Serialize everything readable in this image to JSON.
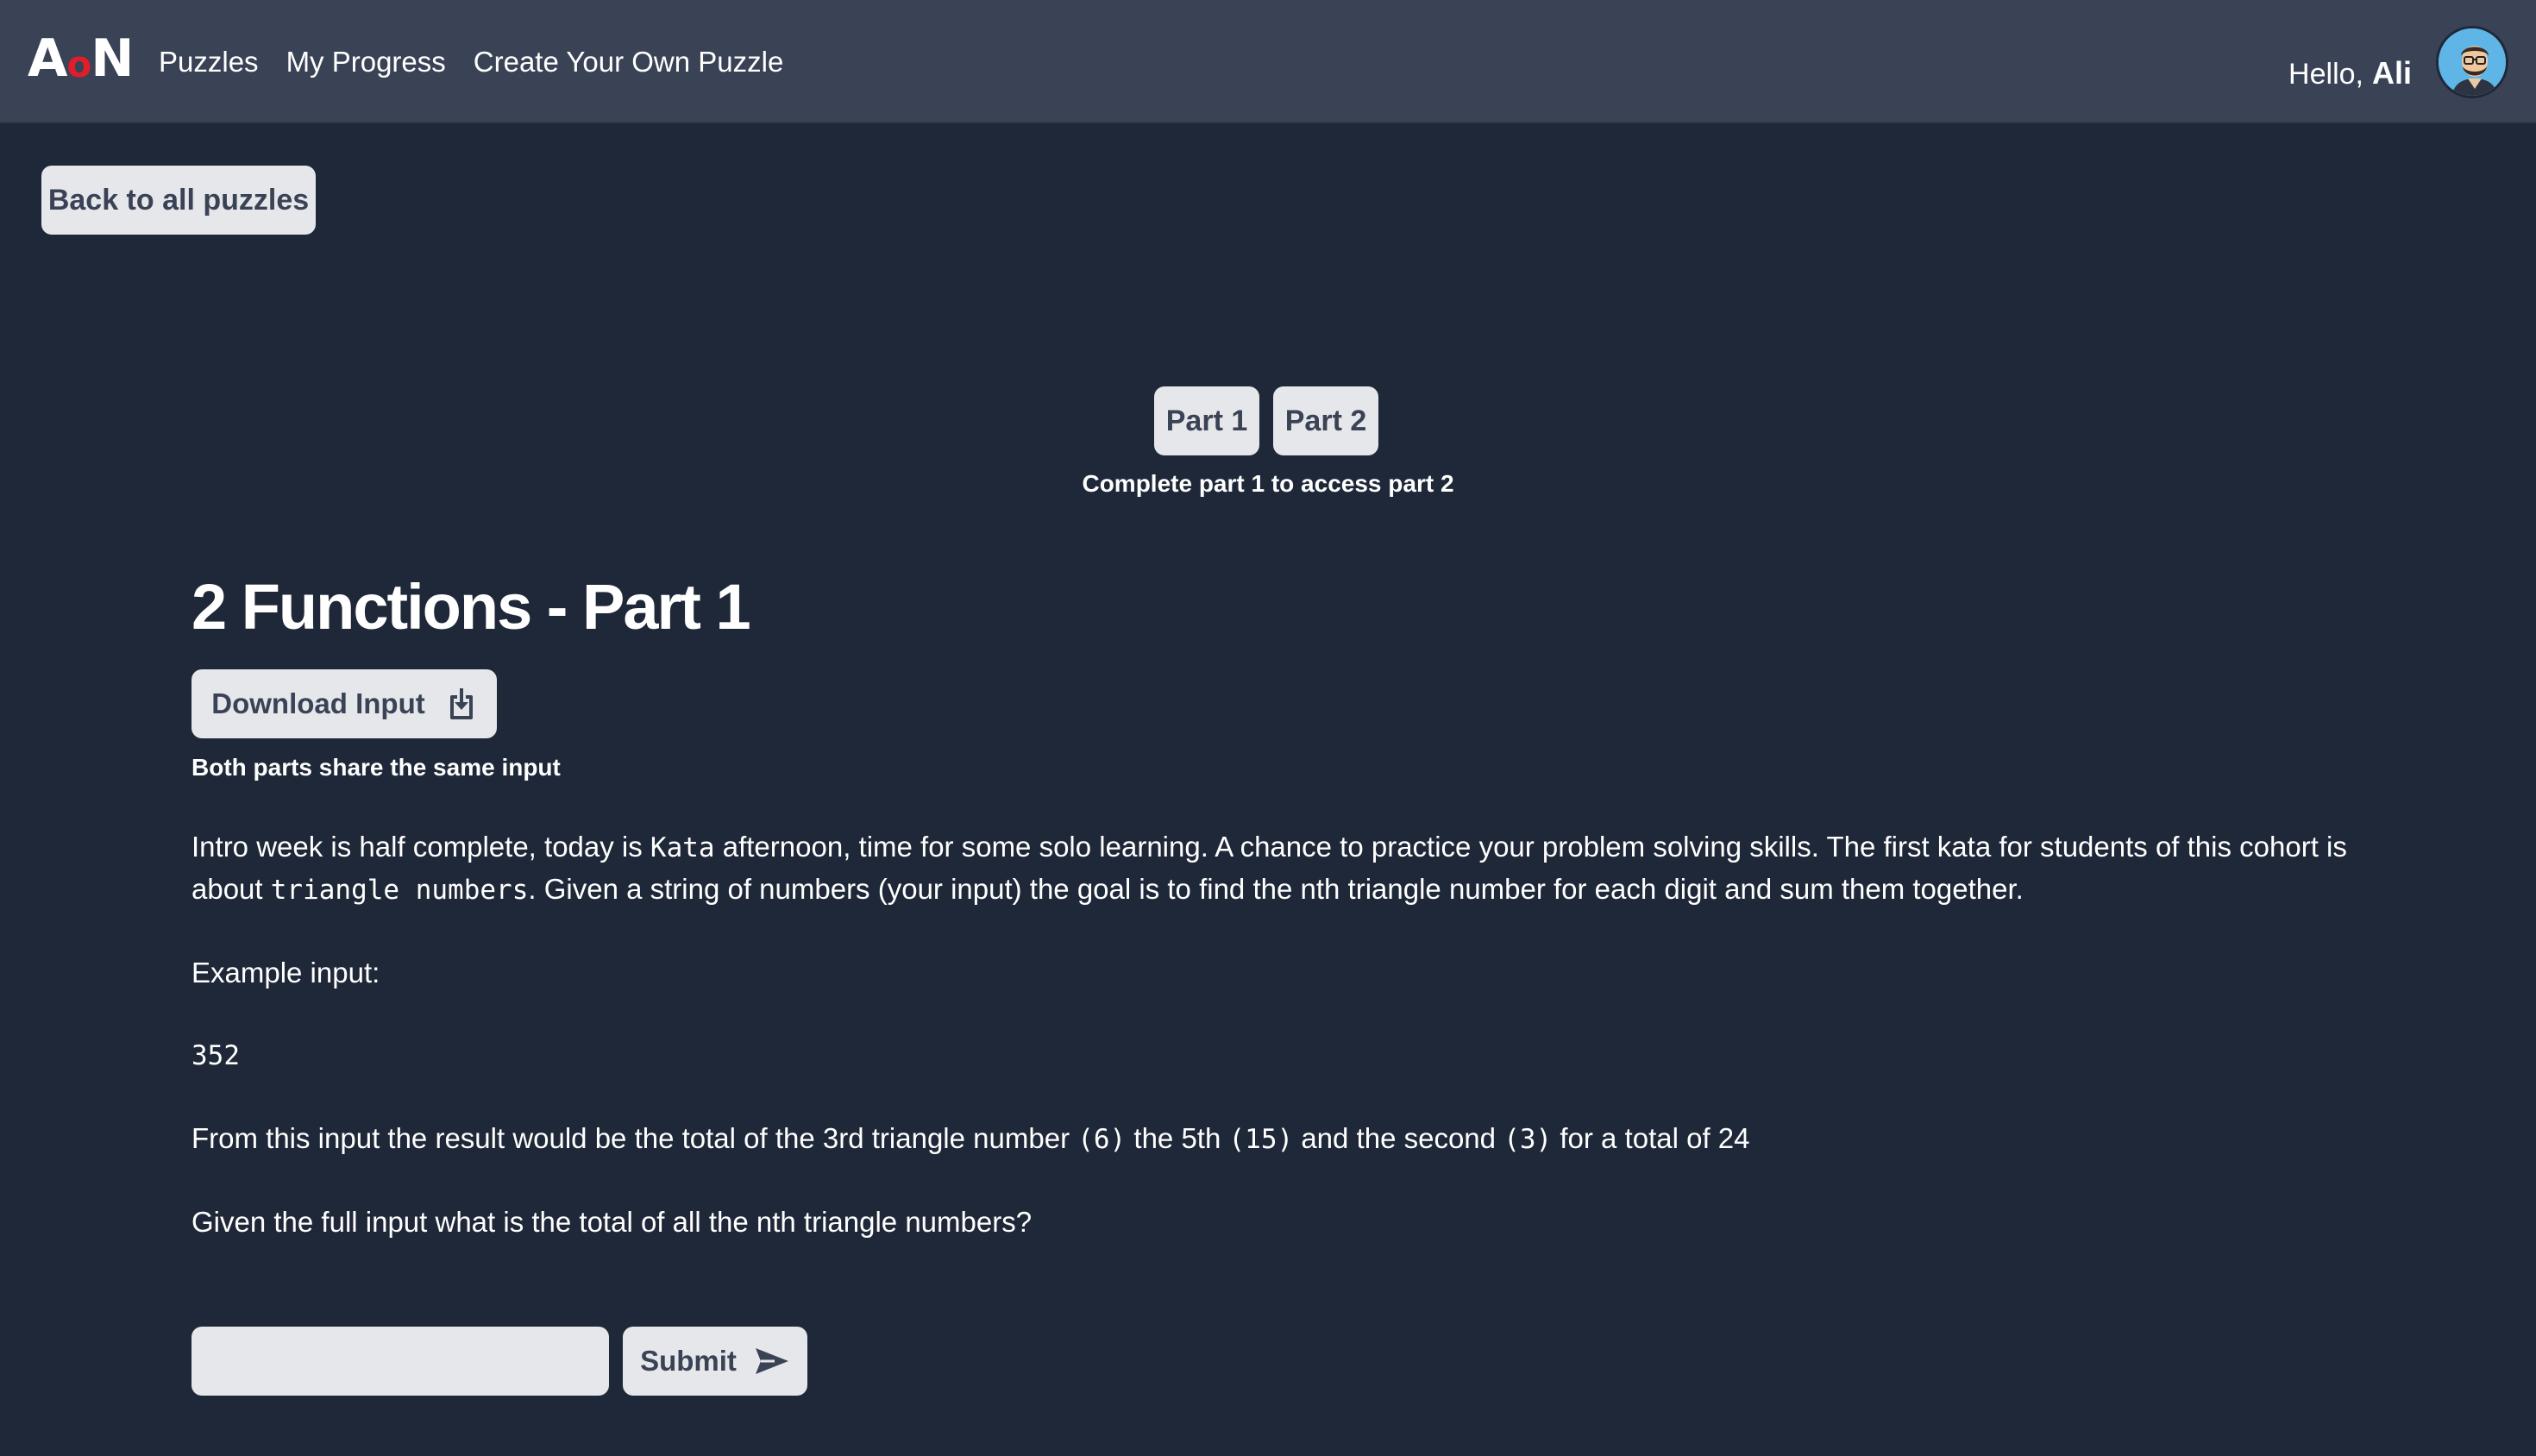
{
  "header": {
    "logo_left": "A",
    "logo_middle": "o",
    "logo_right": "N",
    "nav": [
      "Puzzles",
      "My Progress",
      "Create Your Own Puzzle"
    ],
    "greeting": "Hello,",
    "username": "Ali"
  },
  "back_button": "Back to all puzzles",
  "parts": {
    "part1": "Part 1",
    "part2": "Part 2",
    "note": "Complete part 1 to access part 2"
  },
  "puzzle": {
    "title": "2 Functions - Part 1",
    "download_label": "Download Input",
    "share_note": "Both parts share the same input",
    "p1_a": "Intro week is half complete, today is ",
    "p1_code1": "Kata",
    "p1_b": " afternoon, time for some solo learning. A chance to practice your problem solving skills. The first kata for students of this cohort is about ",
    "p1_code2": "triangle numbers",
    "p1_c": ". Given a string of numbers (your input) the goal is to find the nth triangle number for each digit and sum them together.",
    "example_label": "Example input:",
    "example_value": "352",
    "p3_a": "From this input the result would be the total of the 3rd triangle number ",
    "p3_code1": "(6)",
    "p3_b": " the 5th ",
    "p3_code2": "(15)",
    "p3_c": " and the second ",
    "p3_code3": "(3)",
    "p3_d": " for a total of 24",
    "question": "Given the full input what is the total of all the nth triangle numbers?"
  },
  "answer": {
    "value": "",
    "placeholder": "",
    "submit_label": "Submit"
  },
  "colors": {
    "background": "#1f2838",
    "topbar": "#3a4355",
    "button_bg": "#e5e7eb",
    "button_text": "#3a4355",
    "logo_accent": "#e11d2a"
  },
  "icons": [
    "download-icon",
    "send-icon",
    "avatar"
  ]
}
